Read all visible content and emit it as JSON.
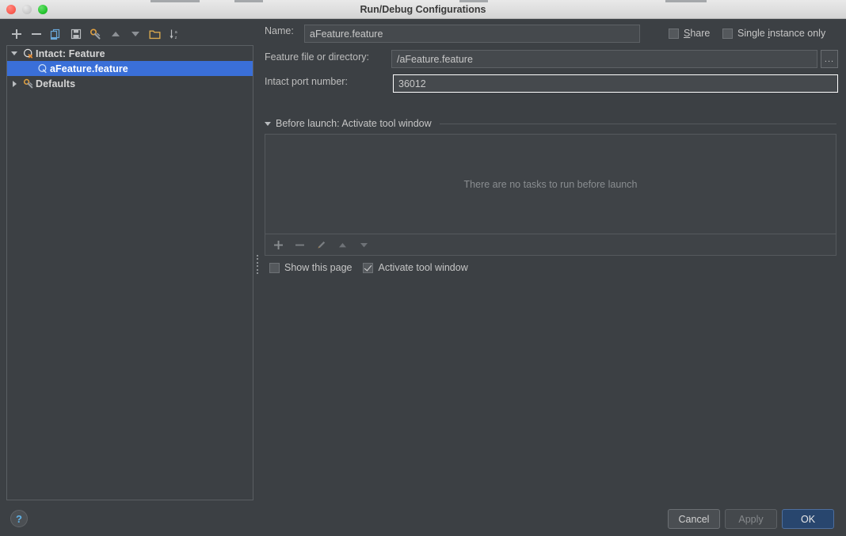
{
  "window": {
    "title": "Run/Debug Configurations",
    "traffic_lights": [
      "close-button",
      "minimize-button",
      "zoom-button"
    ]
  },
  "left_toolbar": {
    "buttons": [
      {
        "name": "add-configuration-button",
        "icon": "plus-icon",
        "tooltip": "Add New Configuration"
      },
      {
        "name": "remove-configuration-button",
        "icon": "minus-icon",
        "tooltip": "Remove Configuration"
      },
      {
        "name": "copy-configuration-button",
        "icon": "copy-icon",
        "tooltip": "Copy Configuration"
      },
      {
        "name": "save-configuration-button",
        "icon": "save-icon",
        "tooltip": "Save Configuration"
      },
      {
        "name": "edit-defaults-button",
        "icon": "wrench-icon",
        "tooltip": "Edit defaults"
      },
      {
        "name": "move-up-button",
        "icon": "arrow-up-icon",
        "tooltip": "Move Up"
      },
      {
        "name": "move-down-button",
        "icon": "arrow-down-icon",
        "tooltip": "Move Down"
      },
      {
        "name": "create-folder-button",
        "icon": "folder-icon",
        "tooltip": "Create New Folder"
      },
      {
        "name": "sort-configurations-button",
        "icon": "sort-alpha-icon",
        "tooltip": "Sort Configurations"
      }
    ]
  },
  "tree": {
    "items": [
      {
        "label": "Intact: Feature",
        "icon": "cucumber-feature-icon",
        "expanded": true,
        "level": 0,
        "selected": false,
        "has_toggle": true
      },
      {
        "label": "aFeature.feature",
        "icon": "cucumber-feature-icon",
        "expanded": false,
        "level": 1,
        "selected": true,
        "has_toggle": false
      },
      {
        "label": "Defaults",
        "icon": "wrench-icon",
        "expanded": false,
        "level": 0,
        "selected": false,
        "has_toggle": true
      }
    ]
  },
  "form": {
    "name_label": "Name:",
    "name_value": "aFeature.feature",
    "share_label": "Share",
    "share_mnemonic": "S",
    "share_checked": false,
    "single_instance_label_pre": "Single ",
    "single_instance_mnemonic": "i",
    "single_instance_label_post": "nstance only",
    "single_instance_checked": false,
    "feature_file_label": "Feature file or directory:",
    "feature_file_value": "/aFeature.feature",
    "browse_button_label": "...",
    "port_label": "Intact port number:",
    "port_value": "36012",
    "port_focused": true
  },
  "before_launch": {
    "header": "Before launch: Activate tool window",
    "expanded": true,
    "empty_text": "There are no tasks to run before launch",
    "toolbar": [
      {
        "name": "add-task-button",
        "icon": "plus-icon",
        "enabled": false
      },
      {
        "name": "remove-task-button",
        "icon": "minus-icon",
        "enabled": false
      },
      {
        "name": "edit-task-button",
        "icon": "pencil-icon",
        "enabled": false
      },
      {
        "name": "task-move-up-button",
        "icon": "arrow-up-icon",
        "enabled": false
      },
      {
        "name": "task-move-down-button",
        "icon": "arrow-down-icon",
        "enabled": false
      }
    ],
    "show_page_label": "Show this page",
    "show_page_checked": false,
    "activate_tool_window_label": "Activate tool window",
    "activate_tool_window_checked": true
  },
  "footer": {
    "help_label": "?",
    "cancel_label": "Cancel",
    "apply_label": "Apply",
    "apply_enabled": false,
    "ok_label": "OK",
    "ok_is_default": true
  },
  "colors": {
    "window_bg": "#3c4044",
    "panel_border": "#5a5f63",
    "selection_blue": "#3a6fd8",
    "ok_button_bg": "#28466e",
    "accent_icon_orange": "#e08a33",
    "accent_icon_blue": "#6aa7d8",
    "help_blue": "#5fb2e8",
    "titlebar_bg": "#dedede"
  }
}
